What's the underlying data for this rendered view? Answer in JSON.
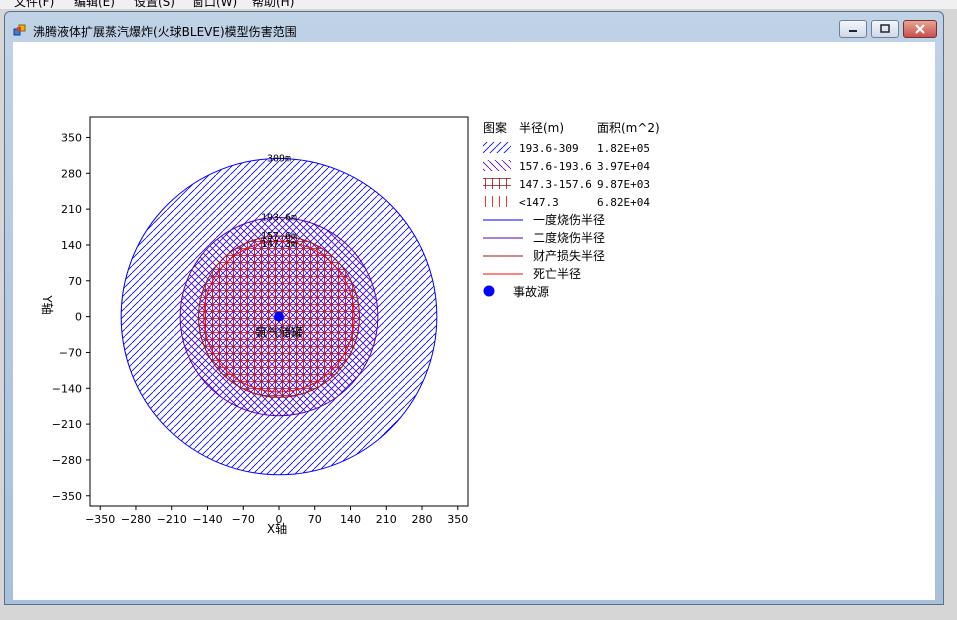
{
  "app": {
    "window_title": "沸腾液体扩展蒸汽爆炸(火球BLEVE)模型伤害范围",
    "menu": [
      "文件(F)",
      "编辑(E)",
      "设置(S)",
      "窗口(W)",
      "帮助(H)"
    ]
  },
  "colors": {
    "first_degree_burn": "#0000ff",
    "second_degree_burn": "#5a00b4",
    "property_loss": "#a01010",
    "death": "#ff0000",
    "source": "#0000ff"
  },
  "chart_data": {
    "type": "area",
    "xlabel": "X轴",
    "ylabel": "Y轴",
    "xlim": [
      -370,
      370
    ],
    "ylim": [
      -370,
      390
    ],
    "xticks": [
      -350,
      -280,
      -210,
      -140,
      -70,
      0,
      70,
      140,
      210,
      280,
      350
    ],
    "yticks": [
      350,
      280,
      210,
      140,
      70,
      0,
      -70,
      -140,
      -210,
      -280,
      -350
    ],
    "xtick_labels": [
      "−350",
      "−280",
      "−210",
      "−140",
      "−70",
      "0",
      "70",
      "140",
      "210",
      "280",
      "350"
    ],
    "ytick_labels": [
      "350",
      "280",
      "210",
      "140",
      "70",
      "0",
      "−70",
      "−140",
      "−210",
      "−280",
      "−350"
    ],
    "grid": false,
    "source": {
      "x": 0,
      "y": 0,
      "label": "氨气储罐"
    },
    "circles": [
      {
        "name": "一度烧伤半径",
        "radius": 309,
        "label": "309m",
        "color": "#0000ff",
        "pattern": "diag-fwd"
      },
      {
        "name": "二度烧伤半径",
        "radius": 193.6,
        "label": "193.6m",
        "color": "#5a00b4",
        "pattern": "diag-back"
      },
      {
        "name": "财产损失半径",
        "radius": 157.6,
        "label": "157.6m",
        "color": "#a01010",
        "pattern": "cross"
      },
      {
        "name": "死亡半径",
        "radius": 147.3,
        "label": "147.3m",
        "color": "#ff0000",
        "pattern": "vert"
      }
    ],
    "legend": {
      "headers": [
        "图案",
        "半径(m)",
        "面积(m^2)"
      ],
      "rows": [
        {
          "radius": "193.6-309",
          "area": "1.82E+05",
          "pattern": "diag-fwd",
          "color": "#0000ff"
        },
        {
          "radius": "157.6-193.6",
          "area": "3.97E+04",
          "pattern": "diag-back",
          "color": "#5a00b4"
        },
        {
          "radius": "147.3-157.6",
          "area": "9.87E+03",
          "pattern": "cross",
          "color": "#a01010"
        },
        {
          "radius": "<147.3",
          "area": "6.82E+04",
          "pattern": "vert",
          "color": "#ff0000"
        }
      ],
      "lines": [
        {
          "label": "一度烧伤半径",
          "color": "#0000ff"
        },
        {
          "label": "二度烧伤半径",
          "color": "#5a00b4"
        },
        {
          "label": "财产损失半径",
          "color": "#a01010"
        },
        {
          "label": "死亡半径",
          "color": "#ff0000"
        }
      ],
      "source_label": "事故源",
      "placement": "right"
    }
  }
}
